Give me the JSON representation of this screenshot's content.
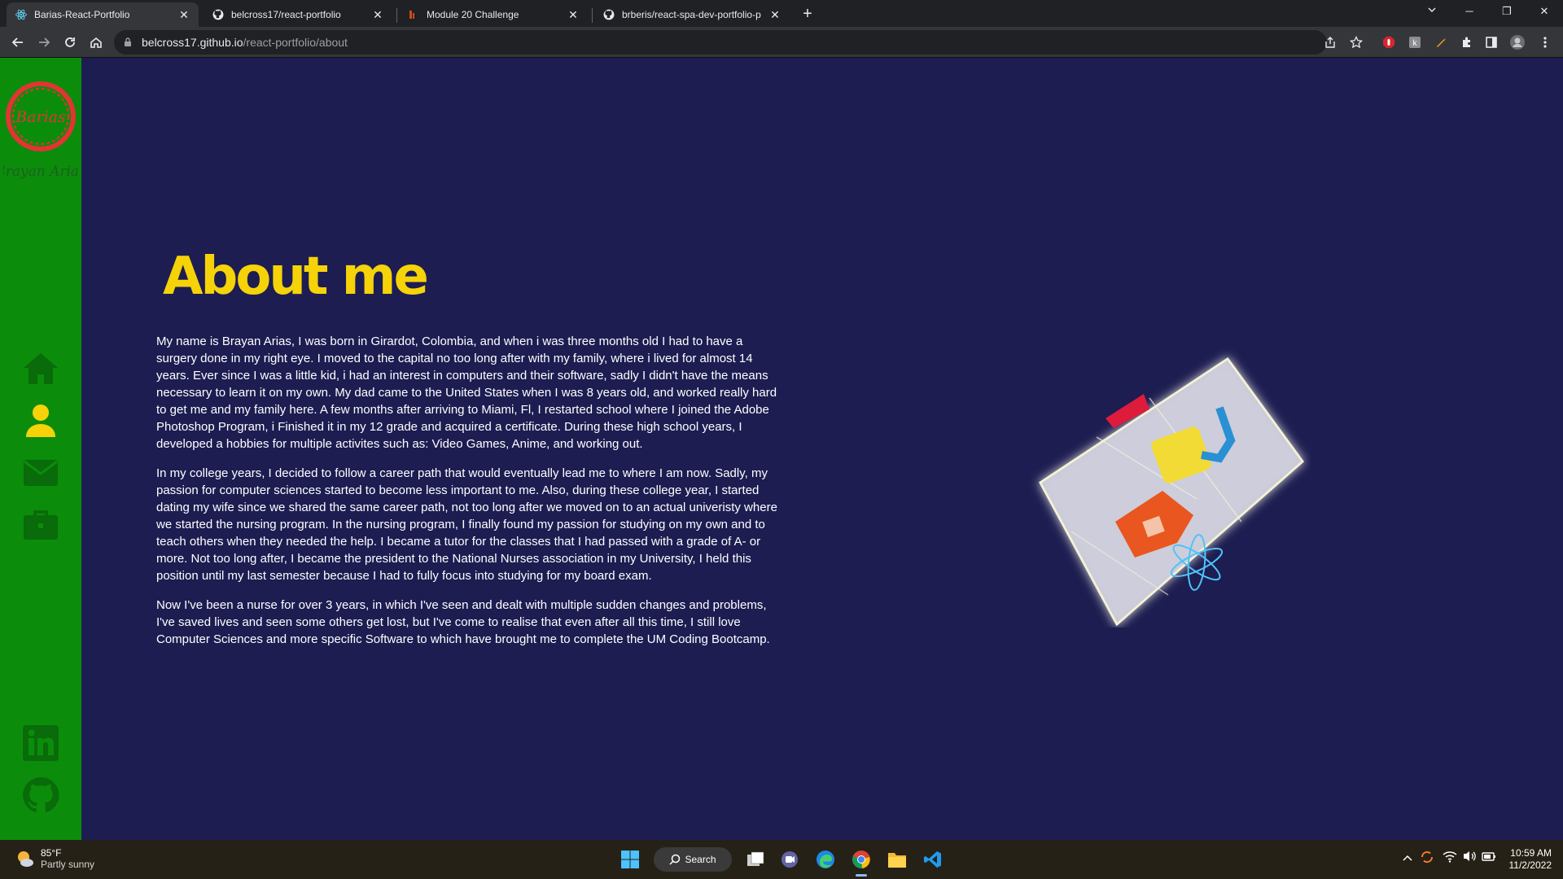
{
  "browser": {
    "tabs": [
      {
        "title": "Barias-React-Portfolio",
        "icon": "react-icon"
      },
      {
        "title": "belcross17/react-portfolio",
        "icon": "github-icon"
      },
      {
        "title": "Module 20 Challenge",
        "icon": "canvas-icon"
      },
      {
        "title": "brberis/react-spa-dev-portfolio-p",
        "icon": "github-icon"
      }
    ],
    "url_host": "belcross17.github.io",
    "url_path": "/react-portfolio/about"
  },
  "logo": {
    "initials": "Barias",
    "signature": "Brayan Arias"
  },
  "about": {
    "title": "About me",
    "paragraphs": [
      "My name is Brayan Arias, I was born in Girardot, Colombia, and when i was three months old I had to have a surgery done in my right eye. I moved to the capital no too long after with my family, where i lived for almost 14 years. Ever since I was a little kid, i had an interest in computers and their software, sadly I didn't have the means necessary to learn it on my own. My dad came to the United States when I was 8 years old, and worked really hard to get me and my family here. A few months after arriving to Miami, Fl, I restarted school where I joined the Adobe Photoshop Program, i Finished it in my 12 grade and acquired a certificate. During these high school years, I developed a hobbies for multiple activites such as: Video Games, Anime, and working out.",
      "In my college years, I decided to follow a career path that would eventually lead me to where I am now. Sadly, my passion for computer sciences started to become less important to me. Also, during these college year, I started dating my wife since we shared the same career path, not too long after we moved on to an actual univeristy where we started the nursing program. In the nursing program, I finally found my passion for studying on my own and to teach others when they needed the help. I became a tutor for the classes that I had passed with a grade of A- or more. Not too long after, I became the president to the National Nurses association in my University, I held this position until my last semester because I had to fully focus into studying for my board exam.",
      "Now I've been a nurse for over 3 years, in which I've seen and dealt with multiple sudden changes and problems, I've saved lives and seen some others get lost, but I've come to realise that even after all this time, I still love Computer Sciences and more specific Software to which have brought me to complete the UM Coding Bootcamp."
    ]
  },
  "colors": {
    "sidebar": "#0b8d0b",
    "background": "#1d1d52",
    "title": "#f5d308",
    "active_icon": "#f5d308"
  },
  "taskbar": {
    "temp": "85°F",
    "condition": "Partly sunny",
    "search_label": "Search",
    "time": "10:59 AM",
    "date": "11/2/2022"
  }
}
